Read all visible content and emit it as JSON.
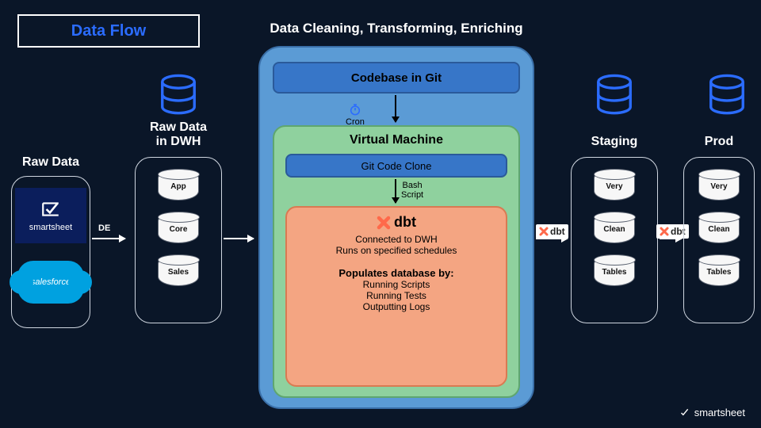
{
  "title": "Data Flow",
  "middle_heading": "Data Cleaning, Transforming, Enriching",
  "cols": {
    "raw": {
      "title": "Raw Data"
    },
    "dwh": {
      "title": "Raw Data\nin DWH",
      "cyls": [
        "App",
        "Core",
        "Sales"
      ]
    },
    "staging": {
      "title": "Staging",
      "cyls": [
        "Very",
        "Clean",
        "Tables"
      ]
    },
    "prod": {
      "title": "Prod",
      "cyls": [
        "Very",
        "Clean",
        "Tables"
      ]
    }
  },
  "logos": {
    "smartsheet": "smartsheet",
    "salesforce": "salesforce"
  },
  "arrows": {
    "de": "DE",
    "cron": "Cron",
    "bash": "Bash\nScript"
  },
  "mid": {
    "git": "Codebase in Git",
    "vm": "Virtual Machine",
    "clone": "Git Code Clone"
  },
  "dbt": {
    "name": "dbt",
    "line1": "Connected to DWH",
    "line2": "Runs on specified schedules",
    "pop_title": "Populates database by:",
    "pop1": "Running Scripts",
    "pop2": "Running Tests",
    "pop3": "Outputting Logs"
  },
  "dbt_tag": "dbt",
  "footer": "smartsheet"
}
